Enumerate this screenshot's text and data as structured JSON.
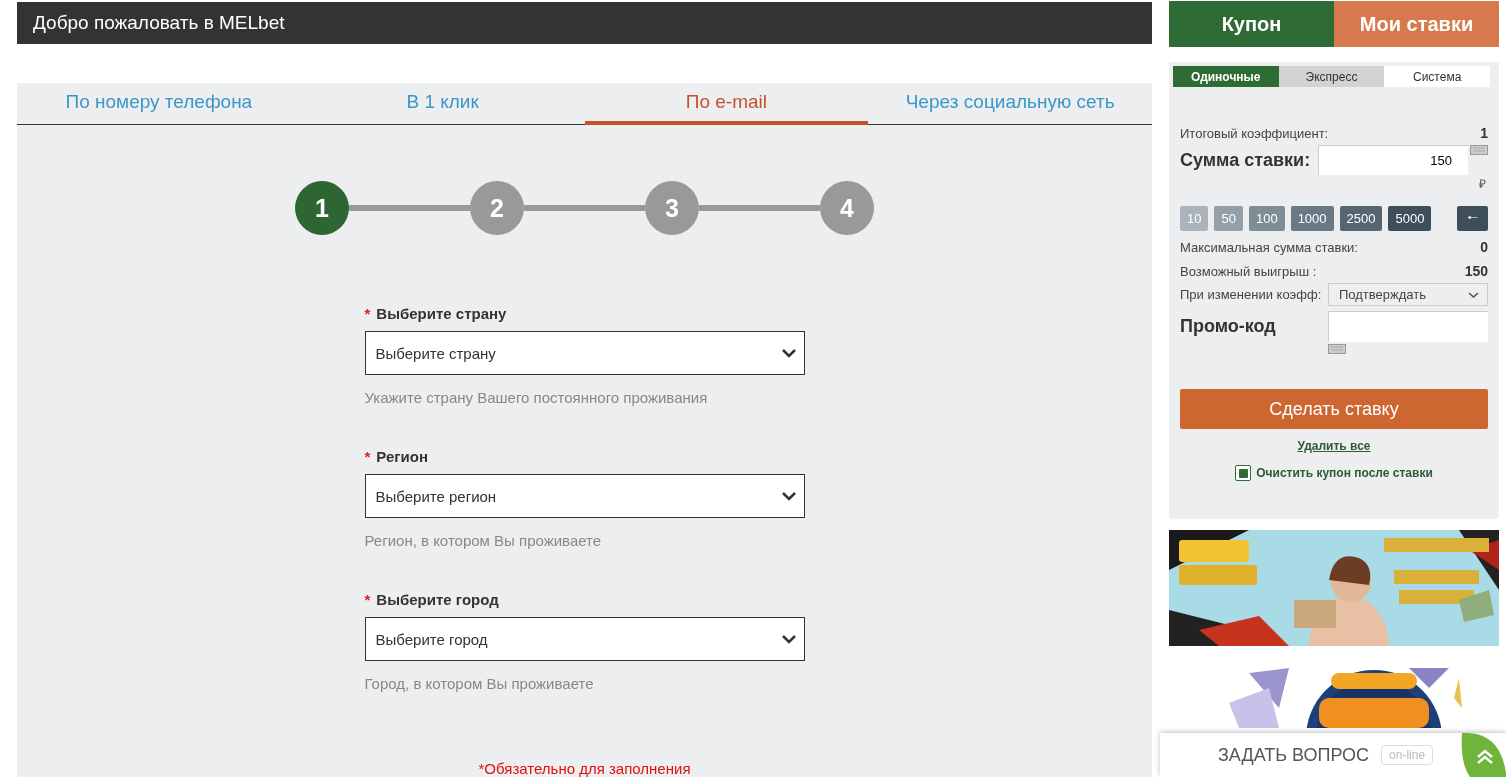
{
  "header": {
    "title": "Добро пожаловать в MELbet"
  },
  "reg_tabs": [
    {
      "label": "По номеру телефона",
      "selected": false
    },
    {
      "label": "В 1 клик",
      "selected": false
    },
    {
      "label": "По e-mail",
      "selected": true
    },
    {
      "label": "Через социальную сеть",
      "selected": false
    }
  ],
  "steps": [
    {
      "label": "1",
      "selected": true
    },
    {
      "label": "2",
      "selected": false
    },
    {
      "label": "3",
      "selected": false
    },
    {
      "label": "4",
      "selected": false
    }
  ],
  "fields": [
    {
      "label": "Выберите страну",
      "required_mark": "*",
      "placeholder": "Выберите страну",
      "hint": "Укажите страну Вашего постоянного проживания"
    },
    {
      "label": "Регион",
      "required_mark": "*",
      "placeholder": "Выберите регион",
      "hint": "Регион, в котором Вы проживаете"
    },
    {
      "label": "Выберите город",
      "required_mark": "*",
      "placeholder": "Выберите город",
      "hint": "Город, в котором Вы проживаете"
    }
  ],
  "required_note": "*Обязательно для заполнения",
  "coupon_tabs": [
    {
      "label": "Купон",
      "selected": true
    },
    {
      "label": "Мои ставки",
      "selected": false
    }
  ],
  "bet_types": [
    {
      "label": "Одиночные",
      "selected": true
    },
    {
      "label": "Экспресс",
      "selected": false
    },
    {
      "label": "Система",
      "selected": false
    }
  ],
  "total_odds": {
    "label": "Итоговый коэффициент:",
    "value": "1"
  },
  "stake": {
    "label": "Сумма ставки:",
    "value": "150",
    "currency": "₽"
  },
  "quick_amounts": [
    "10",
    "50",
    "100",
    "1000",
    "2500",
    "5000"
  ],
  "backspace": "🠐",
  "max_stake": {
    "label": "Максимальная сумма ставки:",
    "value": "0"
  },
  "possible_win": {
    "label": "Возможный выигрыш :",
    "value": "150"
  },
  "odds_change": {
    "label": "При изменении коэфф:",
    "value": "Подтверждать"
  },
  "promo": {
    "label": "Промо-код"
  },
  "place_bet": "Сделать ставку",
  "delete_all": "Удалить все",
  "clear_after": {
    "label": "Очистить купон после ставки",
    "checked": true
  },
  "chat": {
    "label": "ЗАДАТЬ ВОПРОС",
    "badge": "on-line"
  }
}
